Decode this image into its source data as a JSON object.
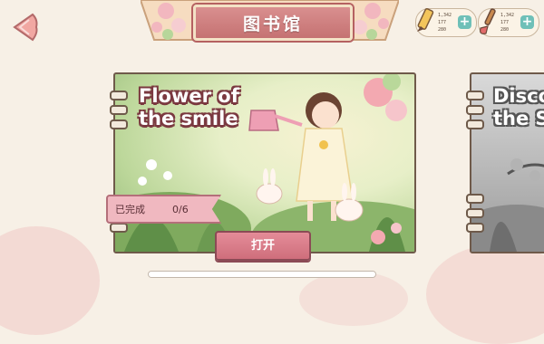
{
  "header": {
    "title": "图书馆",
    "back_icon": "back-arrow-icon"
  },
  "resources": [
    {
      "icon": "pencil-icon",
      "line1": "1,342",
      "line2": "177",
      "line3": "280"
    },
    {
      "icon": "paintbrush-icon",
      "line1": "1,342",
      "line2": "177",
      "line3": "280"
    }
  ],
  "books": [
    {
      "title": "Flower of\nthe smile",
      "progress_label": "已完成",
      "progress": "0/6",
      "open_label": "打开"
    },
    {
      "title": "Disco\nthe S"
    }
  ],
  "colors": {
    "accent": "#d98f8f",
    "button": "#e48c98",
    "plus": "#6fc0b8"
  },
  "carousel": {
    "position": 0
  }
}
